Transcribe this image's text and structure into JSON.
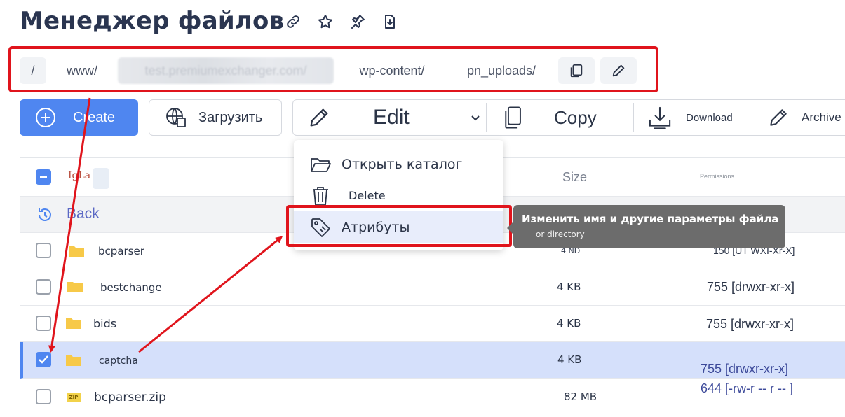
{
  "title": "Менеджер файлов",
  "title_icons": [
    "link-icon",
    "star-icon",
    "pin-icon",
    "download-file-icon"
  ],
  "breadcrumb": {
    "root": "/",
    "items": [
      "www/",
      "test.premiumexchanger.com/",
      "wp-content/",
      "pn_uploads/"
    ],
    "copy_icon": "copy-icon",
    "edit_icon": "pencil-icon"
  },
  "toolbar": {
    "create_label": "Create",
    "upload_label": "Загрузить",
    "edit_label": "Edit",
    "copy_label": "Copy",
    "download_label": "Download",
    "archive_label": "Archive"
  },
  "table": {
    "logo_text": "IgLa",
    "size_header": "Size",
    "permissions_header": "Permissions",
    "back_label": "Back",
    "rows": [
      {
        "name": "bcparser",
        "type": "folder",
        "size": "4 ND",
        "perm": "150 [UT WXI-Xr-X]",
        "checked": false
      },
      {
        "name": "bestchange",
        "type": "folder",
        "size": "4 KB",
        "perm": "755 [drwxr-xr-x]",
        "checked": false
      },
      {
        "name": "bids",
        "type": "folder",
        "size": "4 KB",
        "perm": "755 [drwxr-xr-x]",
        "checked": false
      },
      {
        "name": "captcha",
        "type": "folder",
        "size": "4 KB",
        "perm": "755 [drwxr-xr-x]",
        "checked": true
      },
      {
        "name": "bcparser.zip",
        "type": "zip",
        "size": "82 MB",
        "perm": "644 [-rw-r -- r -- ]",
        "checked": false
      }
    ]
  },
  "context_menu": {
    "open": "Открыть каталог",
    "delete": "Delete",
    "attributes": "Атрибуты"
  },
  "tooltip": {
    "line1": "Изменить имя и другие параметры файла",
    "line2": "or directory"
  },
  "colors": {
    "accent": "#4f86f0",
    "annotation_red": "#e0141c",
    "selected_row": "#d5e0fb",
    "folder": "#f7c948"
  }
}
